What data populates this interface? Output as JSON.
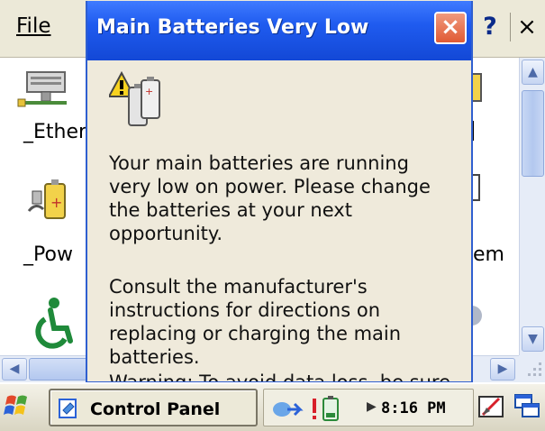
{
  "menubar": {
    "file_label": "File",
    "help_glyph": "?",
    "close_glyph": "×"
  },
  "control_panel": {
    "items": [
      {
        "label": "_Ether",
        "icon": "network-icon"
      },
      {
        "label": "_Pow",
        "icon": "power-icon"
      },
      {
        "label": "",
        "icon": "accessibility-icon"
      }
    ],
    "right_items": [
      {
        "label": "",
        "icon": "display-icon"
      },
      {
        "label": "em",
        "icon": "system-icon"
      },
      {
        "label": "",
        "icon": "globe-icon"
      }
    ]
  },
  "dialog": {
    "title": "Main Batteries Very Low",
    "close_glyph": "×",
    "icon": "battery-warning-icon",
    "paragraphs": [
      "Your main batteries are running very low on power. Please change the batteries at your next opportunity.",
      "Consult the manufacturer's instructions for directions on replacing or charging the main batteries.",
      "Warning: To avoid data loss, be sure"
    ]
  },
  "taskbar": {
    "task_label": "Control Panel",
    "clock": "8:16 PM",
    "accent": "#1f5bef"
  }
}
